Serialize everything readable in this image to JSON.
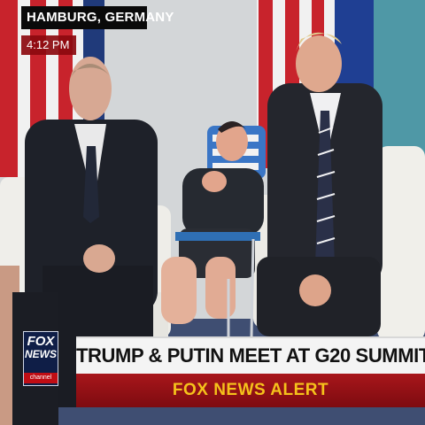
{
  "location_label": "HAMBURG, GERMANY",
  "time_label": "4:12 PM",
  "headline": "TRUMP & PUTIN MEET AT G20 SUMMIT",
  "alert_label": "FOX NEWS ALERT",
  "logo": {
    "line1": "FOX",
    "line2": "NEWS",
    "line3": "channel"
  }
}
